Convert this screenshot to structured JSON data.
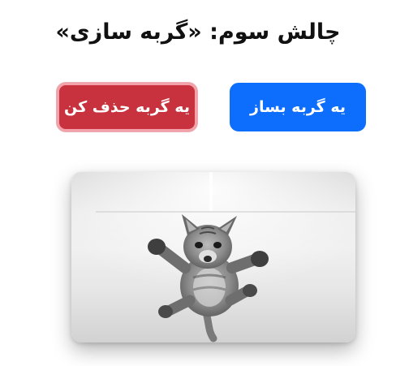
{
  "header": {
    "title": "چالش سوم: «گربه سازی»"
  },
  "buttons": {
    "make_cat_label": "یه گربه بساز",
    "delete_cat_label": "یه گربه حذف کن"
  },
  "image": {
    "subject": "falling-kitten-photo"
  },
  "colors": {
    "primary": "#0d6efd",
    "danger": "#c8323f",
    "danger_outline": "#f3a2aa"
  }
}
